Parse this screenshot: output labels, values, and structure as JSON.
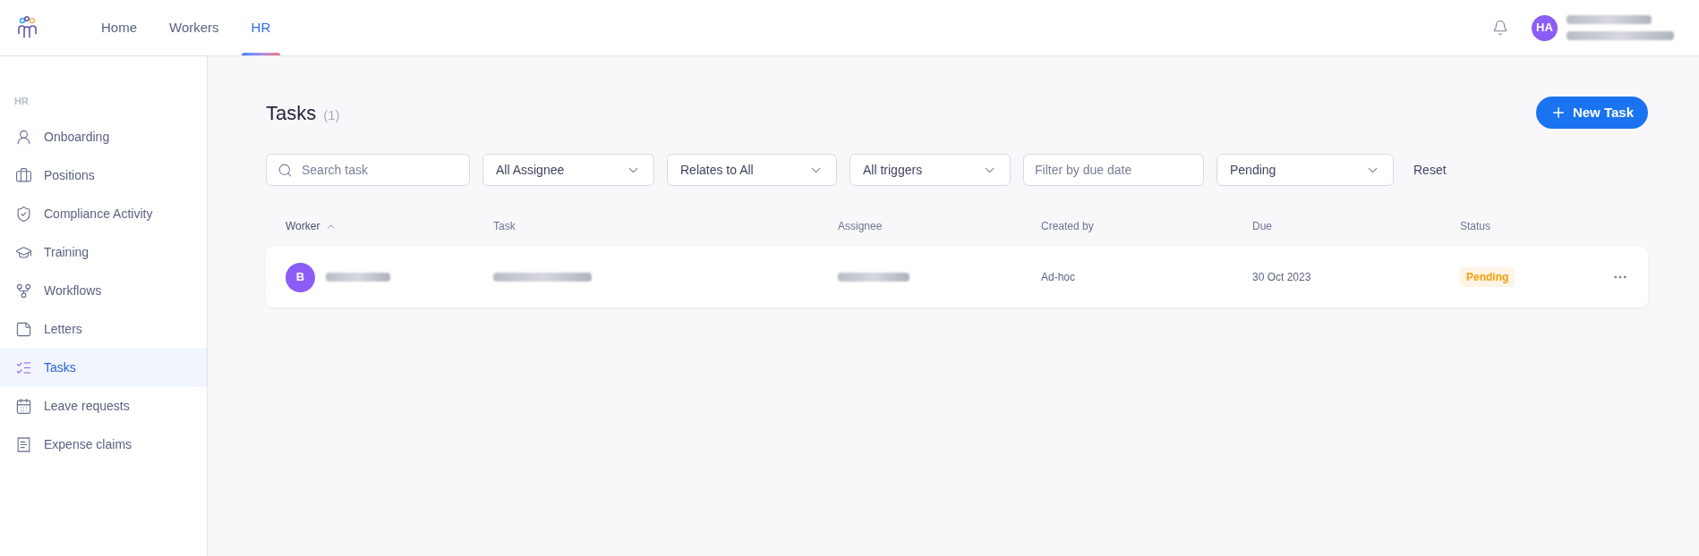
{
  "top_nav": {
    "items": [
      {
        "label": "Home",
        "selected": false
      },
      {
        "label": "Workers",
        "selected": false
      },
      {
        "label": "HR",
        "selected": true
      }
    ],
    "user": {
      "initials": "HA"
    }
  },
  "sidebar": {
    "section": "HR",
    "items": [
      {
        "label": "Onboarding",
        "selected": false
      },
      {
        "label": "Positions",
        "selected": false
      },
      {
        "label": "Compliance Activity",
        "selected": false
      },
      {
        "label": "Training",
        "selected": false
      },
      {
        "label": "Workflows",
        "selected": false
      },
      {
        "label": "Letters",
        "selected": false
      },
      {
        "label": "Tasks",
        "selected": true
      },
      {
        "label": "Leave requests",
        "selected": false
      },
      {
        "label": "Expense claims",
        "selected": false
      }
    ]
  },
  "page": {
    "title": "Tasks",
    "count": "(1)",
    "new_button": "New Task"
  },
  "filters": [
    {
      "kind": "search",
      "placeholder": "Search task"
    },
    {
      "kind": "select",
      "value": "All Assignee"
    },
    {
      "kind": "select",
      "value": "Relates to All"
    },
    {
      "kind": "select",
      "value": "All triggers"
    },
    {
      "kind": "date",
      "placeholder": "Filter by due date"
    },
    {
      "kind": "select",
      "value": "Pending"
    }
  ],
  "reset": "Reset",
  "table": {
    "columns": [
      {
        "label": "Worker",
        "sorted": true
      },
      {
        "label": "Task",
        "sorted": false
      },
      {
        "label": "Assignee",
        "sorted": false
      },
      {
        "label": "Created by",
        "sorted": false
      },
      {
        "label": "Due",
        "sorted": false
      },
      {
        "label": "Status",
        "sorted": false
      }
    ],
    "rows": [
      {
        "initial": "B",
        "created_by": "Ad-hoc",
        "due": "30 Oct 2023",
        "status": "Pending"
      }
    ]
  }
}
